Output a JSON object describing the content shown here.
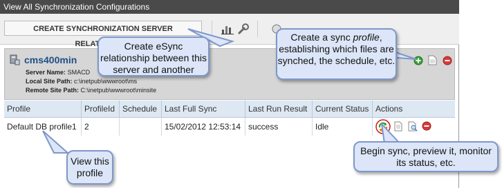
{
  "window": {
    "title": "View All Synchronization Configurations"
  },
  "toolbar": {
    "create_button": "CREATE SYNCHRONIZATION SERVER RELATIONSHIP"
  },
  "server": {
    "name": "cms400min",
    "server_name_label": "Server Name:",
    "server_name_value": "SMACD",
    "local_path_label": "Local Site Path:",
    "local_path_value": "c:\\inetpub\\wwwroot\\ms",
    "remote_path_label": "Remote Site Path:",
    "remote_path_value": "C:\\inetpub\\wwwroot\\minsite"
  },
  "table": {
    "headers": [
      "Profile",
      "ProfileId",
      "Schedule",
      "Last Full Sync",
      "Last Run Result",
      "Current Status",
      "Actions"
    ],
    "rows": [
      {
        "profile": "Default DB profile1",
        "profile_id": "2",
        "schedule": "",
        "last_full_sync": "15/02/2012 12:53:14",
        "last_run_result": "success",
        "current_status": "Idle"
      }
    ]
  },
  "callouts": {
    "create_esync": "Create eSync relationship between this server and another",
    "create_profile_pre": "Create a sync ",
    "create_profile_em": "profile",
    "create_profile_post": ", establishing which files are synched, the schedule, etc.",
    "begin_sync": "Begin sync, preview it, monitor its status, etc.",
    "view_profile": "View this profile"
  },
  "colors": {
    "titlebar": "#4a4a4a",
    "header_bg": "#dde8f3",
    "bubble_bg": "#dce6f8",
    "bubble_border": "#7f97c9",
    "link": "#1f4f86"
  }
}
